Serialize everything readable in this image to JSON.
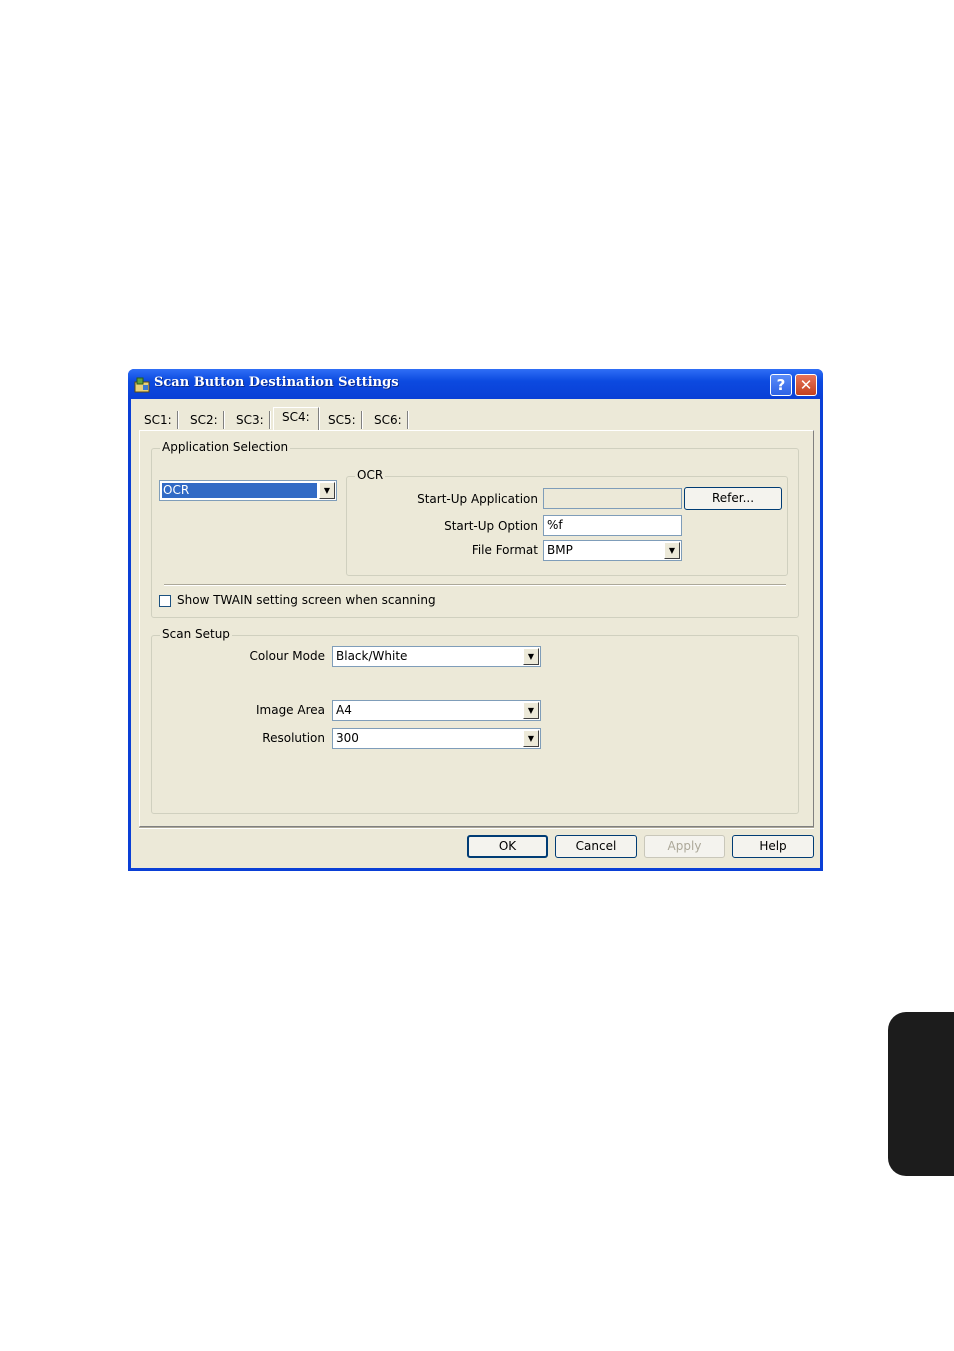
{
  "window": {
    "title": "Scan Button Destination Settings",
    "help_glyph": "?",
    "close_glyph": "✕"
  },
  "tabs": [
    {
      "label": "SC1:"
    },
    {
      "label": "SC2:"
    },
    {
      "label": "SC3:"
    },
    {
      "label": "SC4:"
    },
    {
      "label": "SC5:"
    },
    {
      "label": "SC6:"
    }
  ],
  "app_selection": {
    "group_label": "Application Selection",
    "selected_app": "OCR",
    "ocr_group_label": "OCR",
    "startup_app_label": "Start-Up Application",
    "startup_app_value": "",
    "refer_label": "Refer...",
    "startup_option_label": "Start-Up Option",
    "startup_option_value": "%f",
    "file_format_label": "File Format",
    "file_format_value": "BMP",
    "show_twain_label": "Show TWAIN setting screen when scanning"
  },
  "scan_setup": {
    "group_label": "Scan Setup",
    "colour_mode_label": "Colour Mode",
    "colour_mode_value": "Black/White",
    "image_area_label": "Image Area",
    "image_area_value": "A4",
    "resolution_label": "Resolution",
    "resolution_value": "300"
  },
  "footer": {
    "ok_label": "OK",
    "cancel_label": "Cancel",
    "apply_label": "Apply",
    "help_label": "Help"
  },
  "icons": {
    "dropdown": "▼"
  }
}
